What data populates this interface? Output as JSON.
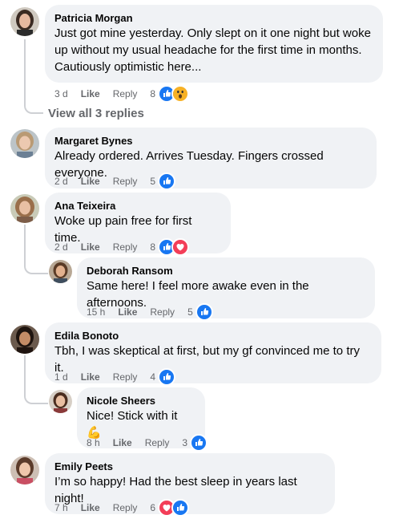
{
  "comments": [
    {
      "name": "Patricia Morgan",
      "lines": [
        "Just got mine yesterday. Only slept on it one night but woke",
        "up without my usual headache for the first time in months.",
        "Cautiously optimistic here..."
      ],
      "time": "3 d",
      "like": "Like",
      "reply": "Reply",
      "count": "8",
      "reactions": [
        "like-icon",
        "wow-icon"
      ]
    },
    {
      "name": "Margaret Bynes",
      "lines": [
        "Already ordered. Arrives Tuesday. Fingers crossed everyone."
      ],
      "time": "2 d",
      "like": "Like",
      "reply": "Reply",
      "count": "5",
      "reactions": [
        "like-icon"
      ]
    },
    {
      "name": "Ana Teixeira",
      "lines": [
        "Woke up pain free for first time."
      ],
      "time": "2 d",
      "like": "Like",
      "reply": "Reply",
      "count": "8",
      "reactions": [
        "like-icon",
        "love-icon"
      ]
    },
    {
      "name": "Deborah Ransom",
      "lines": [
        "Same here! I feel more awake even in the afternoons."
      ],
      "time": "15 h",
      "like": "Like",
      "reply": "Reply",
      "count": "5",
      "reactions": [
        "like-icon"
      ]
    },
    {
      "name": "Edila Bonoto",
      "lines": [
        "Tbh, I was skeptical at first, but my gf convinced me to try it."
      ],
      "time": "1 d",
      "like": "Like",
      "reply": "Reply",
      "count": "4",
      "reactions": [
        "like-icon"
      ]
    },
    {
      "name": "Nicole Sheers",
      "lines": [
        "Nice! Stick with it 💪"
      ],
      "time": "8 h",
      "like": "Like",
      "reply": "Reply",
      "count": "3",
      "reactions": [
        "like-icon"
      ]
    },
    {
      "name": "Emily Peets",
      "lines": [
        "I’m so happy! Had the best sleep in years last night!"
      ],
      "time": "7 h",
      "like": "Like",
      "reply": "Reply",
      "count": "6",
      "reactions": [
        "love-icon",
        "like-icon"
      ]
    }
  ],
  "view_all": "View all 3 replies",
  "colors": {
    "like": "#1877f2",
    "love": "#f33e58",
    "wow": "#f7b125",
    "bubble": "#f0f2f5",
    "meta": "#65676b"
  }
}
